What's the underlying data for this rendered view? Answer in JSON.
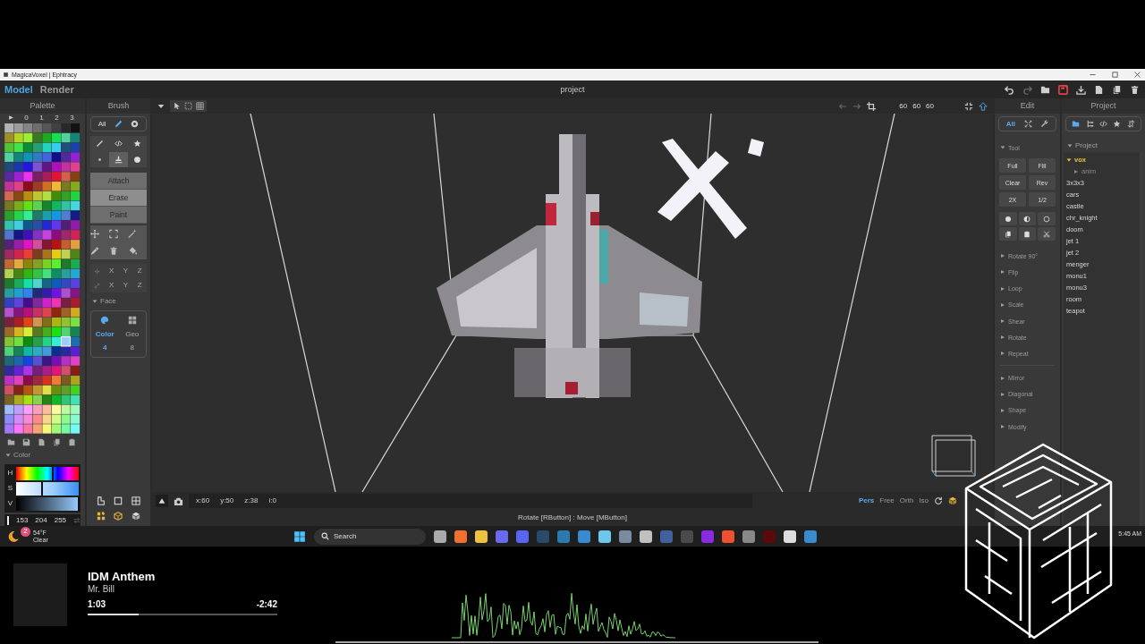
{
  "window": {
    "title": "MagicaVoxel | Ephtracy"
  },
  "mode_tabs": [
    {
      "label": "Model",
      "selected": true
    },
    {
      "label": "Render",
      "selected": false
    }
  ],
  "document_title": "project",
  "palette": {
    "header": "Palette",
    "columns": [
      "0",
      "1",
      "2",
      "3"
    ]
  },
  "brush": {
    "header": "Brush",
    "all_label": "All",
    "shapes": [
      {
        "selected": false
      },
      {
        "selected": false
      },
      {
        "selected": false
      },
      {
        "selected": false
      },
      {
        "selected": true
      },
      {
        "selected": false
      }
    ],
    "actions": [
      {
        "label": "Attach",
        "selected": false
      },
      {
        "label": "Erase",
        "selected": true
      },
      {
        "label": "Paint",
        "selected": false
      }
    ],
    "axis_rows": [
      [
        "X",
        "Y",
        "Z"
      ],
      [
        "X",
        "Y",
        "Z"
      ]
    ],
    "face": {
      "header": "Face",
      "expanded": true,
      "modes": [
        {
          "label": "Color",
          "value": "4",
          "selected": true
        },
        {
          "label": "Geo",
          "value": "8",
          "selected": false
        }
      ]
    }
  },
  "color": {
    "header": "Color",
    "expanded": true,
    "channels": [
      {
        "label": "H",
        "level": 0.58
      },
      {
        "label": "S",
        "level": 0.41
      },
      {
        "label": "V",
        "level": 1
      }
    ],
    "rgb": [
      "153",
      "204",
      "255"
    ]
  },
  "viewport": {
    "size": [
      "60",
      "60",
      "60"
    ],
    "coords": [
      "x:60",
      "y:50",
      "z:38",
      "i:0"
    ],
    "views": [
      {
        "label": "Pers",
        "selected": true
      },
      {
        "label": "Free",
        "selected": false
      },
      {
        "label": "Orth",
        "selected": false
      },
      {
        "label": "Iso",
        "selected": false
      }
    ],
    "hint": "Rotate [RButton] : Move [MButton]"
  },
  "edit": {
    "header": "Edit",
    "tabs": [
      {
        "kind": "text",
        "label": "All",
        "selected": true
      },
      {
        "kind": "icon",
        "selected": false
      },
      {
        "kind": "icon",
        "selected": false
      }
    ],
    "tool": {
      "label": "Tool",
      "expanded": true,
      "buttons": [
        "Full",
        "Fill",
        "Clear",
        "Rev",
        "2X",
        "1/2"
      ]
    },
    "section_groups": [
      [
        {
          "label": "Rotate 90°",
          "expanded": false
        },
        {
          "label": "Flip",
          "expanded": false
        },
        {
          "label": "Loop",
          "expanded": false
        },
        {
          "label": "Scale",
          "expanded": false
        },
        {
          "label": "Shear",
          "expanded": false
        },
        {
          "label": "Rotate",
          "expanded": false
        },
        {
          "label": "Repeat",
          "expanded": false
        }
      ],
      [
        {
          "label": "Mirror",
          "expanded": false
        },
        {
          "label": "Diagonal",
          "expanded": false
        },
        {
          "label": "Shape",
          "expanded": false
        },
        {
          "label": "Modify",
          "expanded": false
        }
      ]
    ]
  },
  "project": {
    "header": "Project",
    "tabs": [
      {
        "selected": true
      },
      {
        "selected": false
      },
      {
        "selected": false
      },
      {
        "selected": false
      },
      {
        "selected": false
      }
    ],
    "section": {
      "label": "Project",
      "expanded": true
    },
    "tree": [
      {
        "label": "vox",
        "selected": true,
        "expanded": true,
        "children": [
          {
            "label": "anim",
            "selected": false,
            "expanded": false
          }
        ]
      },
      {
        "label": "3x3x3",
        "selected": false
      },
      {
        "label": "cars",
        "selected": false
      },
      {
        "label": "castle",
        "selected": false
      },
      {
        "label": "chr_knight",
        "selected": false
      },
      {
        "label": "doom",
        "selected": false
      },
      {
        "label": "jet 1",
        "selected": false
      },
      {
        "label": "jet 2",
        "selected": false
      },
      {
        "label": "menger",
        "selected": false
      },
      {
        "label": "monu1",
        "selected": false
      },
      {
        "label": "monu3",
        "selected": false
      },
      {
        "label": "room",
        "selected": false
      },
      {
        "label": "teapot",
        "selected": false
      }
    ]
  },
  "taskbar": {
    "weather": {
      "badge": "2",
      "temperature": "54°F",
      "condition": "Clear"
    },
    "search": {
      "placeholder": "Search"
    },
    "time": "5:45 AM"
  },
  "player": {
    "title": "IDM Anthem",
    "artist": "Mr. Bill",
    "elapsed": "1:03",
    "remaining": "-2:42",
    "level": 0.27
  }
}
